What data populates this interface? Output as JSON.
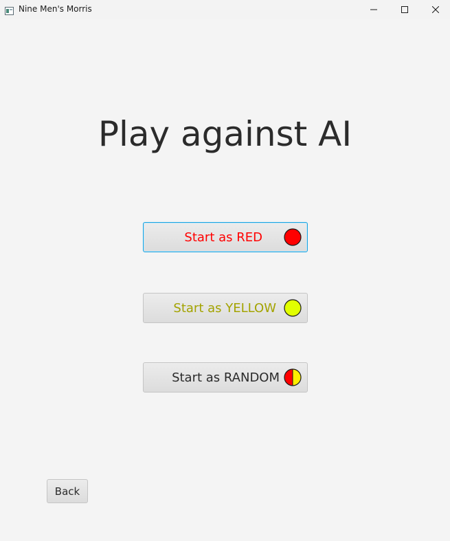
{
  "window": {
    "title": "Nine Men's Morris"
  },
  "main": {
    "title": "Play against AI",
    "buttons": [
      {
        "label": "Start as RED",
        "color": "#ff0000",
        "icon": "red-piece-icon"
      },
      {
        "label": "Start as YELLOW",
        "color": "#a3a300",
        "icon": "yellow-piece-icon"
      },
      {
        "label": "Start as RANDOM",
        "color": "#2b2b2b",
        "icon": "random-piece-icon"
      }
    ],
    "back_label": "Back"
  },
  "colors": {
    "red": "#ff0000",
    "yellow": "#e1ff00",
    "focus_border": "#1aa2e0",
    "background": "#f4f4f4"
  }
}
